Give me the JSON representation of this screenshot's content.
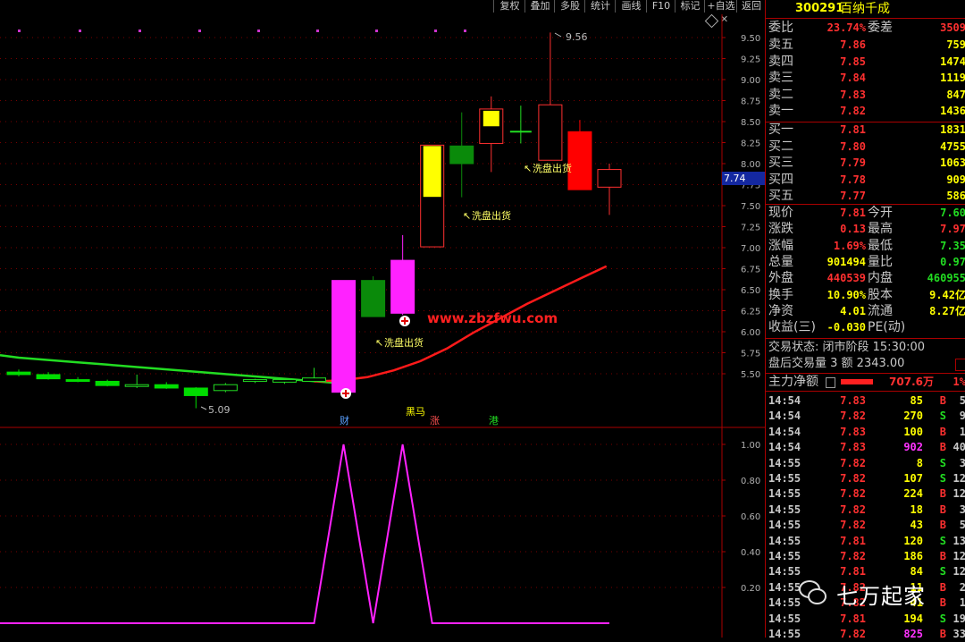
{
  "toolbar": {
    "buttons": [
      "复权",
      "叠加",
      "多股",
      "统计",
      "画线",
      "F10",
      "标记",
      "+自选",
      "返回"
    ],
    "pin_icon": "pin-icon"
  },
  "chart_data": [
    {
      "type": "candlestick",
      "y_range": [
        5.3,
        9.6
      ],
      "y_ticks": [
        "9.50",
        "9.25",
        "9.00",
        "8.75",
        "8.50",
        "8.25",
        "8.00",
        "7.75",
        "7.50",
        "7.25",
        "7.00",
        "6.75",
        "6.50",
        "6.25",
        "6.00",
        "5.75",
        "5.50"
      ],
      "current_price_label": "7.74",
      "candles": [
        {
          "o": 5.52,
          "c": 5.49,
          "h": 5.55,
          "l": 5.47,
          "color": "green"
        },
        {
          "o": 5.49,
          "c": 5.44,
          "h": 5.52,
          "l": 5.43,
          "color": "green"
        },
        {
          "o": 5.43,
          "c": 5.43,
          "h": 5.46,
          "l": 5.4,
          "color": "green"
        },
        {
          "o": 5.41,
          "c": 5.36,
          "h": 5.43,
          "l": 5.35,
          "color": "green"
        },
        {
          "o": 5.36,
          "c": 5.37,
          "h": 5.49,
          "l": 5.33,
          "color": "hollow-green"
        },
        {
          "o": 5.37,
          "c": 5.33,
          "h": 5.4,
          "l": 5.32,
          "color": "green"
        },
        {
          "o": 5.33,
          "c": 5.24,
          "h": 5.34,
          "l": 5.09,
          "color": "green"
        },
        {
          "o": 5.3,
          "c": 5.37,
          "h": 5.39,
          "l": 5.28,
          "color": "hollow-green"
        },
        {
          "o": 5.41,
          "c": 5.43,
          "h": 5.44,
          "l": 5.39,
          "color": "hollow-green"
        },
        {
          "o": 5.4,
          "c": 5.43,
          "h": 5.44,
          "l": 5.38,
          "color": "hollow-green"
        },
        {
          "o": 5.41,
          "c": 5.45,
          "h": 5.57,
          "l": 5.4,
          "color": "hollow-green"
        },
        {
          "o": 5.28,
          "c": 6.61,
          "h": 6.61,
          "l": 5.28,
          "color": "magenta"
        },
        {
          "o": 6.61,
          "c": 6.18,
          "h": 6.66,
          "l": 6.18,
          "color": "green"
        },
        {
          "o": 6.22,
          "c": 6.85,
          "h": 7.15,
          "l": 6.2,
          "color": "magenta"
        },
        {
          "o": 7.01,
          "c": 8.22,
          "h": 8.22,
          "l": 7.01,
          "color": "hollow-yellow-bottom"
        },
        {
          "o": 8.21,
          "c": 8.0,
          "h": 8.61,
          "l": 7.6,
          "color": "green"
        },
        {
          "o": 8.24,
          "c": 8.65,
          "h": 8.8,
          "l": 7.9,
          "color": "yellow-top"
        },
        {
          "o": 8.38,
          "c": 8.38,
          "h": 8.69,
          "l": 8.24,
          "color": "green-doji"
        },
        {
          "o": 8.7,
          "c": 8.04,
          "h": 9.56,
          "l": 8.04,
          "color": "hollow-red"
        },
        {
          "o": 8.38,
          "c": 7.69,
          "h": 8.52,
          "l": 7.69,
          "color": "red"
        },
        {
          "o": 7.72,
          "c": 7.93,
          "h": 8.0,
          "l": 7.39,
          "color": "hollow-red"
        }
      ],
      "annotations": [
        {
          "text": "9.56"
        },
        {
          "text": "5.09"
        },
        {
          "text": "洗盘出货"
        },
        {
          "text": "洗盘出货"
        },
        {
          "text": "洗盘出货"
        }
      ],
      "ma_line": {
        "color": "#ff1a1a"
      },
      "long_ma_line": {
        "color": "#22dd22"
      },
      "watermark": "www.zbzfwu.com",
      "bottom_markers": [
        {
          "text": "财",
          "color": "#5aa0ff"
        },
        {
          "text": "黑马",
          "color": "#ffff00"
        },
        {
          "text": "涨",
          "color": "#ff5050"
        },
        {
          "text": "港",
          "color": "#22dd22"
        }
      ]
    },
    {
      "type": "line",
      "y_range": [
        0,
        1.05
      ],
      "y_ticks": [
        "1.00",
        "0.80",
        "0.60",
        "0.40",
        "0.20"
      ],
      "values": [
        0,
        0,
        0,
        0,
        0,
        0,
        0,
        0,
        0,
        0,
        0,
        1,
        0,
        1,
        0,
        0,
        0,
        0,
        0,
        0,
        0
      ],
      "color": "#ff22ff"
    }
  ],
  "quote": {
    "code": "300291",
    "name": "百纳千成",
    "weibi_label": "委比",
    "weibi_value": "23.74%",
    "weicha_label": "委差",
    "weicha_value": "3509",
    "sell": [
      {
        "label": "卖五",
        "price": "7.86",
        "vol": "759"
      },
      {
        "label": "卖四",
        "price": "7.85",
        "vol": "1474"
      },
      {
        "label": "卖三",
        "price": "7.84",
        "vol": "1119"
      },
      {
        "label": "卖二",
        "price": "7.83",
        "vol": "847"
      },
      {
        "label": "卖一",
        "price": "7.82",
        "vol": "1436"
      }
    ],
    "buy": [
      {
        "label": "买一",
        "price": "7.81",
        "vol": "1831"
      },
      {
        "label": "买二",
        "price": "7.80",
        "vol": "4755"
      },
      {
        "label": "买三",
        "price": "7.79",
        "vol": "1063"
      },
      {
        "label": "买四",
        "price": "7.78",
        "vol": "909"
      },
      {
        "label": "买五",
        "price": "7.77",
        "vol": "586"
      }
    ],
    "stats": [
      {
        "l1": "现价",
        "v1": "7.81",
        "c1": "#ff3030",
        "l2": "今开",
        "v2": "7.60",
        "c2": "#22dd22"
      },
      {
        "l1": "涨跌",
        "v1": "0.13",
        "c1": "#ff3030",
        "l2": "最高",
        "v2": "7.97",
        "c2": "#ff3030"
      },
      {
        "l1": "涨幅",
        "v1": "1.69%",
        "c1": "#ff3030",
        "l2": "最低",
        "v2": "7.35",
        "c2": "#22dd22"
      },
      {
        "l1": "总量",
        "v1": "901494",
        "c1": "#ffff00",
        "l2": "量比",
        "v2": "0.97",
        "c2": "#22dd22"
      },
      {
        "l1": "外盘",
        "v1": "440539",
        "c1": "#ff3030",
        "l2": "内盘",
        "v2": "460955",
        "c2": "#22dd22"
      },
      {
        "l1": "换手",
        "v1": "10.90%",
        "c1": "#ffff00",
        "l2": "股本",
        "v2": "9.42亿",
        "c2": "#ffff00"
      },
      {
        "l1": "净资",
        "v1": "4.01",
        "c1": "#ffff00",
        "l2": "流通",
        "v2": "8.27亿",
        "c2": "#ffff00"
      },
      {
        "l1": "收益(三)",
        "v1": "-0.030",
        "c1": "#ffff00",
        "l2": "PE(动)",
        "v2": "",
        "c2": "#ffff00"
      }
    ],
    "trade_status": "交易状态: 闭市阶段 15:30:00",
    "after_hours": "盘后交易量 3 额 2343.00",
    "main_flow_label": "主力净额",
    "main_flow_value": "707.6万",
    "main_flow_pct": "1%",
    "ticks": [
      {
        "t": "14:54",
        "p": "7.83",
        "pc": "#ff3030",
        "v": "85",
        "vc": "#ffff00",
        "bs": "B",
        "n": "5"
      },
      {
        "t": "14:54",
        "p": "7.82",
        "pc": "#ff3030",
        "v": "270",
        "vc": "#ffff00",
        "bs": "S",
        "n": "9"
      },
      {
        "t": "14:54",
        "p": "7.83",
        "pc": "#ff3030",
        "v": "100",
        "vc": "#ffff00",
        "bs": "B",
        "n": "1"
      },
      {
        "t": "14:54",
        "p": "7.83",
        "pc": "#ff3030",
        "v": "902",
        "vc": "#ff33ff",
        "bs": "B",
        "n": "40"
      },
      {
        "t": "14:55",
        "p": "7.82",
        "pc": "#ff3030",
        "v": "8",
        "vc": "#ffff00",
        "bs": "S",
        "n": "3"
      },
      {
        "t": "14:55",
        "p": "7.82",
        "pc": "#ff3030",
        "v": "107",
        "vc": "#ffff00",
        "bs": "S",
        "n": "12"
      },
      {
        "t": "14:55",
        "p": "7.82",
        "pc": "#ff3030",
        "v": "224",
        "vc": "#ffff00",
        "bs": "B",
        "n": "12"
      },
      {
        "t": "14:55",
        "p": "7.82",
        "pc": "#ff3030",
        "v": "18",
        "vc": "#ffff00",
        "bs": "B",
        "n": "3"
      },
      {
        "t": "14:55",
        "p": "7.82",
        "pc": "#ff3030",
        "v": "43",
        "vc": "#ffff00",
        "bs": "B",
        "n": "5"
      },
      {
        "t": "14:55",
        "p": "7.81",
        "pc": "#ff3030",
        "v": "120",
        "vc": "#ffff00",
        "bs": "S",
        "n": "13"
      },
      {
        "t": "14:55",
        "p": "7.82",
        "pc": "#ff3030",
        "v": "186",
        "vc": "#ffff00",
        "bs": "B",
        "n": "12"
      },
      {
        "t": "14:55",
        "p": "7.81",
        "pc": "#ff3030",
        "v": "84",
        "vc": "#ffff00",
        "bs": "S",
        "n": "12"
      },
      {
        "t": "14:55",
        "p": "7.82",
        "pc": "#ff3030",
        "v": "11",
        "vc": "#ffff00",
        "bs": "B",
        "n": "2"
      },
      {
        "t": "14:55",
        "p": "7.82",
        "pc": "#ff3030",
        "v": "41",
        "vc": "#ffff00",
        "bs": "B",
        "n": "1"
      },
      {
        "t": "14:55",
        "p": "7.81",
        "pc": "#ff3030",
        "v": "194",
        "vc": "#ffff00",
        "bs": "S",
        "n": "19"
      },
      {
        "t": "14:55",
        "p": "7.82",
        "pc": "#ff3030",
        "v": "825",
        "vc": "#ff33ff",
        "bs": "B",
        "n": "33"
      }
    ]
  },
  "wechat_badge": {
    "icon": "wechat-icon",
    "text": "七万起家"
  }
}
